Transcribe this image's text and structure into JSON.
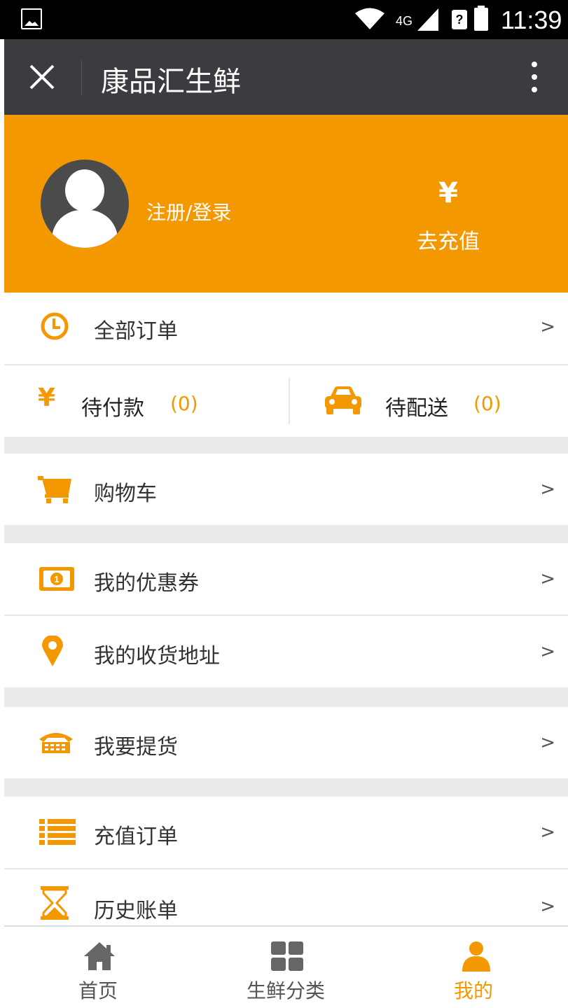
{
  "status_bar": {
    "network": "4G",
    "sim_label": "?",
    "time": "11:39"
  },
  "title_bar": {
    "title": "康品汇生鲜"
  },
  "profile": {
    "login_label": "注册/登录",
    "recharge_symbol": "¥",
    "recharge_label": "去充值"
  },
  "orders": {
    "all_orders_label": "全部订单",
    "pending_payment": {
      "symbol": "¥",
      "label": "待付款",
      "count": "(0)"
    },
    "pending_delivery": {
      "label": "待配送",
      "count": "(0)"
    }
  },
  "menu": {
    "cart": "购物车",
    "coupons": "我的优惠券",
    "addresses": "我的收货地址",
    "pickup": "我要提货",
    "recharge_orders": "充值订单",
    "history": "历史账单"
  },
  "chevron": ">",
  "tabbar": [
    {
      "label": "首页",
      "icon": "home-icon",
      "active": false
    },
    {
      "label": "生鲜分类",
      "icon": "grid-icon",
      "active": false
    },
    {
      "label": "我的",
      "icon": "user-icon",
      "active": true
    }
  ],
  "colors": {
    "accent": "#f39800",
    "titlebar": "#3b3c3f",
    "gap": "#ebebeb"
  }
}
